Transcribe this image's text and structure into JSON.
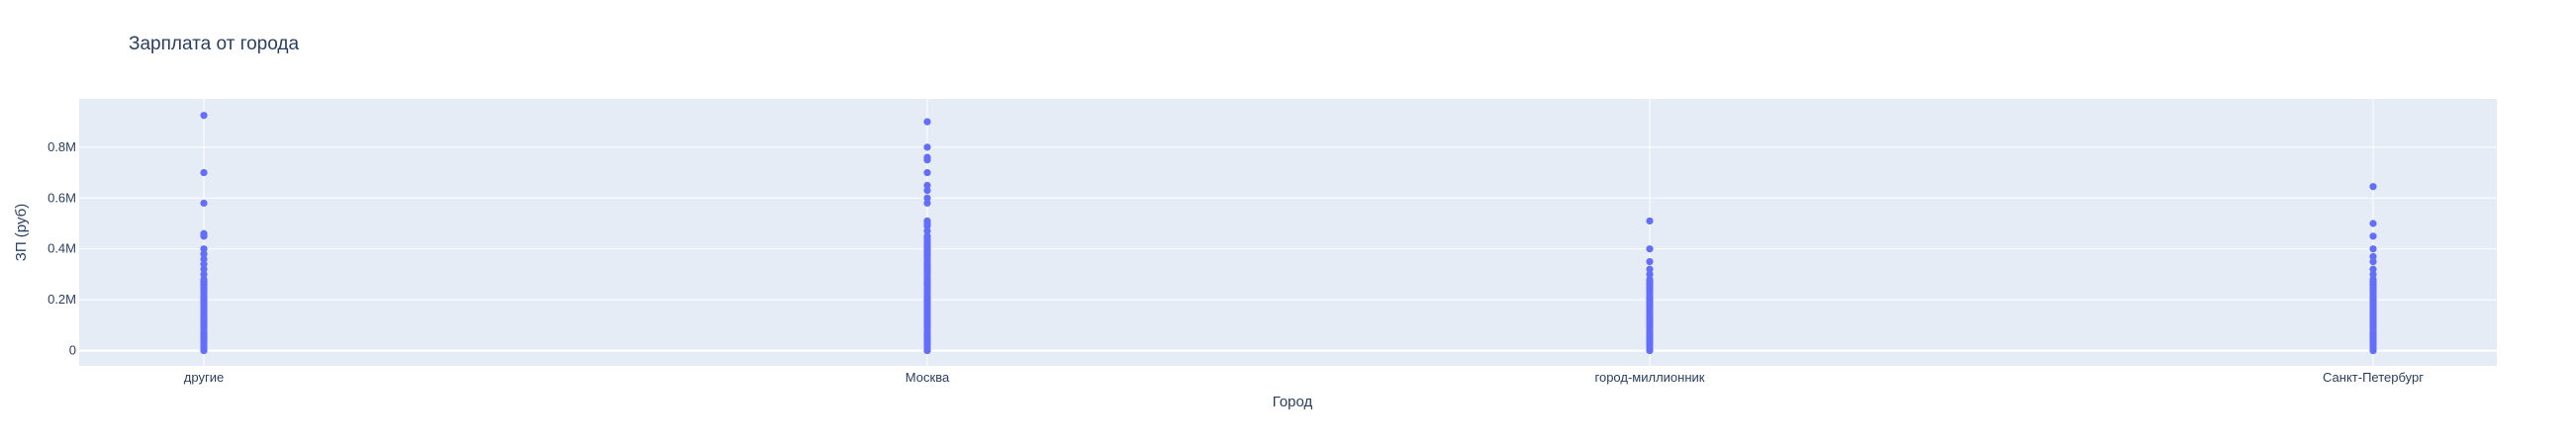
{
  "chart_data": {
    "type": "scatter",
    "title": "Зарплата от города",
    "xlabel": "Город",
    "ylabel": "ЗП (руб)",
    "categories": [
      "другие",
      "Москва",
      "город-миллионник",
      "Санкт-Петербург"
    ],
    "y_ticks": [
      {
        "value": 0,
        "label": "0"
      },
      {
        "value": 200000,
        "label": "0.2M"
      },
      {
        "value": 400000,
        "label": "0.4M"
      },
      {
        "value": 600000,
        "label": "0.6M"
      },
      {
        "value": 800000,
        "label": "0.8M"
      }
    ],
    "ylim": [
      -60000,
      990000
    ],
    "grid": true,
    "marker_color": "#636efa",
    "plot_bgcolor": "#e5ecf6",
    "series": [
      {
        "values": [
          [
            0,
            10000,
            20000,
            30000,
            40000,
            50000,
            60000,
            70000,
            80000,
            90000,
            100000,
            110000,
            120000,
            130000,
            140000,
            150000,
            160000,
            170000,
            180000,
            190000,
            200000,
            210000,
            220000,
            230000,
            240000,
            250000,
            260000,
            270000,
            280000,
            300000,
            320000,
            340000,
            360000,
            380000,
            400000,
            450000,
            460000,
            580000,
            700000,
            925000
          ],
          [
            0,
            10000,
            20000,
            30000,
            40000,
            50000,
            60000,
            70000,
            80000,
            90000,
            100000,
            110000,
            120000,
            130000,
            140000,
            150000,
            160000,
            170000,
            180000,
            190000,
            200000,
            210000,
            220000,
            230000,
            240000,
            250000,
            260000,
            270000,
            280000,
            290000,
            300000,
            310000,
            320000,
            330000,
            340000,
            350000,
            360000,
            370000,
            380000,
            390000,
            400000,
            410000,
            420000,
            430000,
            440000,
            450000,
            470000,
            490000,
            500000,
            510000,
            580000,
            600000,
            630000,
            650000,
            700000,
            750000,
            760000,
            800000,
            900000
          ],
          [
            0,
            10000,
            20000,
            30000,
            40000,
            50000,
            60000,
            70000,
            80000,
            90000,
            100000,
            110000,
            120000,
            130000,
            140000,
            150000,
            160000,
            170000,
            180000,
            190000,
            200000,
            210000,
            220000,
            230000,
            240000,
            250000,
            260000,
            270000,
            280000,
            300000,
            320000,
            350000,
            400000,
            510000
          ],
          [
            0,
            10000,
            20000,
            30000,
            40000,
            50000,
            60000,
            70000,
            80000,
            90000,
            100000,
            110000,
            120000,
            130000,
            140000,
            150000,
            160000,
            170000,
            180000,
            190000,
            200000,
            210000,
            220000,
            230000,
            240000,
            250000,
            260000,
            270000,
            280000,
            300000,
            320000,
            350000,
            370000,
            400000,
            450000,
            500000,
            645000
          ]
        ]
      }
    ]
  }
}
